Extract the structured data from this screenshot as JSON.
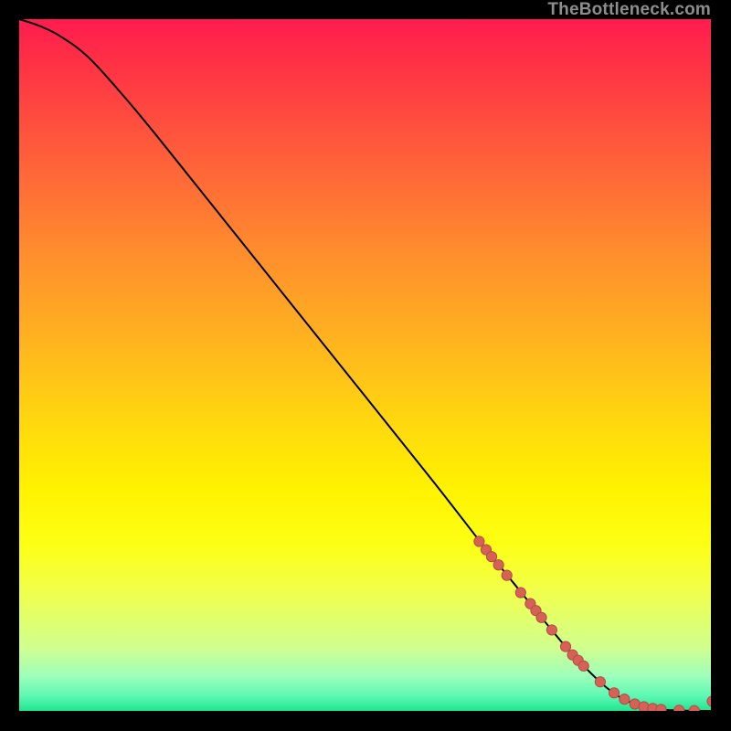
{
  "watermark": "TheBottleneck.com",
  "colors": {
    "watermark": "#8d8d8d",
    "curve": "#000000",
    "points_fill": "#d76157",
    "points_stroke": "#b14d45",
    "gradient_stops": [
      "#ff1c4f",
      "#ff3045",
      "#ff5f3a",
      "#ff8b2e",
      "#ffb220",
      "#ffd70f",
      "#fff300",
      "#fdff15",
      "#f0ff4e",
      "#cfff8f",
      "#9dffbc",
      "#59f7b2",
      "#20e58e"
    ]
  },
  "chart_data": {
    "type": "line",
    "title": "",
    "xlabel": "",
    "ylabel": "",
    "xlim": [
      0,
      100
    ],
    "ylim": [
      0,
      100
    ],
    "series": [
      {
        "name": "curve",
        "x": [
          0,
          3,
          6,
          10,
          15,
          20,
          30,
          40,
          50,
          60,
          67,
          70,
          73,
          76,
          79,
          82,
          85,
          88,
          92,
          96,
          100
        ],
        "values": [
          100,
          99,
          97.5,
          94.5,
          89,
          83,
          70.5,
          58,
          45.5,
          33,
          24,
          20.3,
          16.6,
          12.9,
          9.3,
          6.1,
          3.3,
          1.4,
          0.3,
          0.05,
          0
        ]
      }
    ],
    "points": [
      {
        "x": 66.5,
        "y": 24.5
      },
      {
        "x": 67.5,
        "y": 23.3
      },
      {
        "x": 68.3,
        "y": 22.3
      },
      {
        "x": 69.3,
        "y": 21.1
      },
      {
        "x": 70.5,
        "y": 19.6
      },
      {
        "x": 72.5,
        "y": 17.1
      },
      {
        "x": 73.9,
        "y": 15.5
      },
      {
        "x": 74.7,
        "y": 14.5
      },
      {
        "x": 75.5,
        "y": 13.5
      },
      {
        "x": 77.0,
        "y": 11.7
      },
      {
        "x": 79.0,
        "y": 9.3
      },
      {
        "x": 80.0,
        "y": 8.1
      },
      {
        "x": 80.8,
        "y": 7.3
      },
      {
        "x": 81.6,
        "y": 6.5
      },
      {
        "x": 84.0,
        "y": 4.2
      },
      {
        "x": 86.0,
        "y": 2.6
      },
      {
        "x": 87.5,
        "y": 1.7
      },
      {
        "x": 89.0,
        "y": 1.0
      },
      {
        "x": 90.3,
        "y": 0.6
      },
      {
        "x": 91.6,
        "y": 0.35
      },
      {
        "x": 92.8,
        "y": 0.2
      },
      {
        "x": 95.4,
        "y": 0.08
      },
      {
        "x": 97.6,
        "y": 0.03
      },
      {
        "x": 100.2,
        "y": 1.4
      }
    ],
    "point_radius": 5.6
  }
}
